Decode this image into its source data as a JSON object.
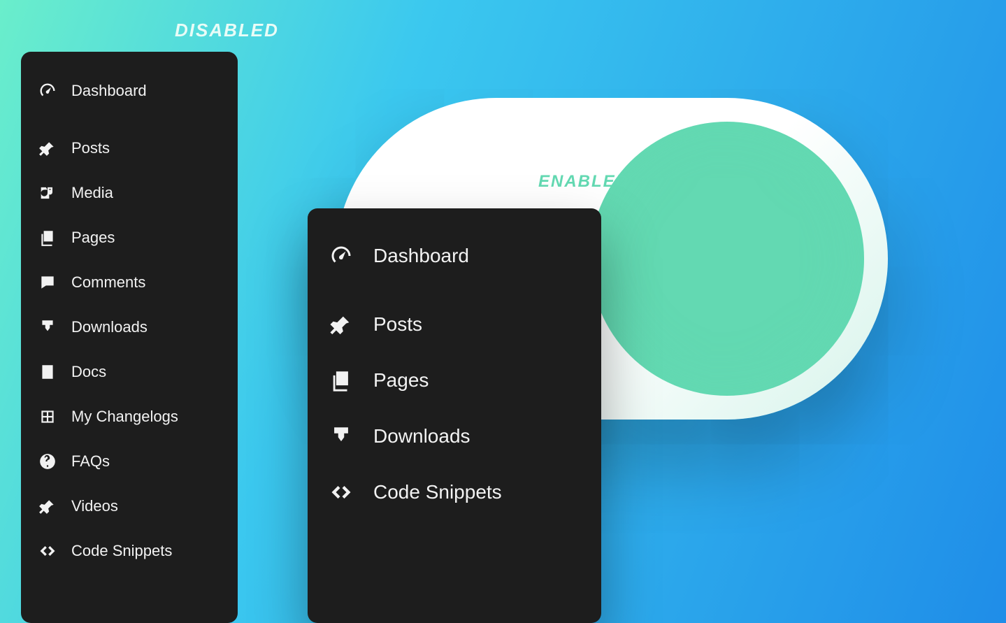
{
  "badges": {
    "disabled": "DISABLED",
    "enabled": "ENABLED"
  },
  "colors": {
    "sidebar_bg": "#1d1d1d",
    "toggle_knob": "#63d9b2",
    "toggle_track": "#ffffff"
  },
  "sidebar_disabled": {
    "items": [
      {
        "label": "Dashboard",
        "icon": "gauge"
      },
      {
        "label": "Posts",
        "icon": "pin"
      },
      {
        "label": "Media",
        "icon": "camera-music"
      },
      {
        "label": "Pages",
        "icon": "stack"
      },
      {
        "label": "Comments",
        "icon": "comment"
      },
      {
        "label": "Downloads",
        "icon": "download"
      },
      {
        "label": "Docs",
        "icon": "doc"
      },
      {
        "label": "My Changelogs",
        "icon": "grid"
      },
      {
        "label": "FAQs",
        "icon": "question"
      },
      {
        "label": "Videos",
        "icon": "pin"
      },
      {
        "label": "Code Snippets",
        "icon": "code"
      }
    ]
  },
  "sidebar_enabled": {
    "items": [
      {
        "label": "Dashboard",
        "icon": "gauge"
      },
      {
        "label": "Posts",
        "icon": "pin"
      },
      {
        "label": "Pages",
        "icon": "stack"
      },
      {
        "label": "Downloads",
        "icon": "download"
      },
      {
        "label": "Code Snippets",
        "icon": "code"
      }
    ]
  }
}
